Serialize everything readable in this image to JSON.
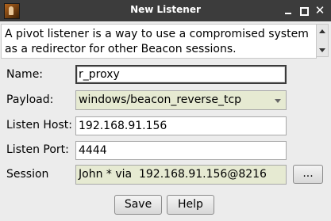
{
  "window": {
    "title": "New Listener"
  },
  "description": "A pivot listener is a way to use a compromised system as a redirector for other Beacon sessions.",
  "form": {
    "name": {
      "label": "Name:",
      "value": "r_proxy"
    },
    "payload": {
      "label": "Payload:",
      "value": "windows/beacon_reverse_tcp"
    },
    "listen_host": {
      "label": "Listen Host:",
      "value": "192.168.91.156"
    },
    "listen_port": {
      "label": "Listen Port:",
      "value": "4444"
    },
    "session": {
      "label": "Session",
      "value": "John * via  192.168.91.156@8216",
      "browse_label": "..."
    }
  },
  "buttons": {
    "save": "Save",
    "help": "Help"
  }
}
